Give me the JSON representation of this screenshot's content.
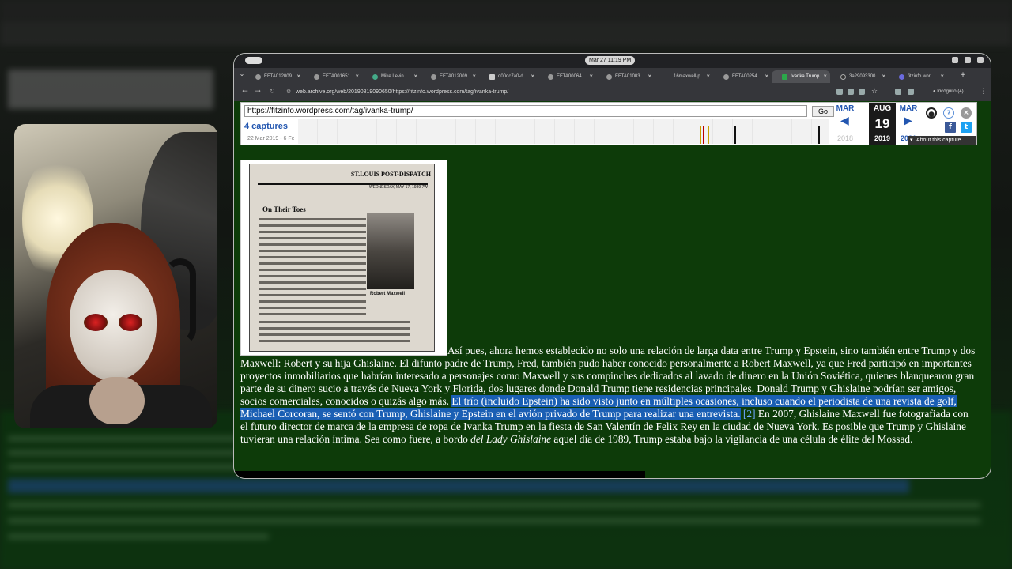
{
  "window": {
    "clock": "Mar 27  11:19 PM"
  },
  "tabs": [
    {
      "label": "EFTA012009"
    },
    {
      "label": "EFTA001651"
    },
    {
      "label": "Mike Levin"
    },
    {
      "label": "EFTA012009"
    },
    {
      "label": "d00dc7a0-d"
    },
    {
      "label": "EFTA00064"
    },
    {
      "label": "EFTA01003"
    },
    {
      "label": "16maxwell-p"
    },
    {
      "label": "EFTA00254"
    },
    {
      "label": "Ivanka Trump"
    },
    {
      "label": "3a29093300"
    },
    {
      "label": "fitzinfo.wor"
    }
  ],
  "address": {
    "url": "web.archive.org/web/20190819090650/https://fitzinfo.wordpress.com/tag/ivanka-trump/",
    "profile": "Incógnito (4)"
  },
  "wayback": {
    "url": "https://fitzinfo.wordpress.com/tag/ivanka-trump/",
    "go": "Go",
    "captures": "4 captures",
    "daterange": "22 Mar 2019 - 6 Fe",
    "prev_month": "MAR",
    "cur_month": "AUG",
    "next_month": "MAR",
    "day": "19",
    "prev_year": "2018",
    "cur_year": "2019",
    "next_year": "2021",
    "about": "About this capture"
  },
  "clipping": {
    "paper": "ST.LOUIS POST-DISPATCH",
    "date": "WEDNESDAY, MAY 17, 1989  7W",
    "headline": "On Their Toes",
    "caption": "Robert Maxwell"
  },
  "article": {
    "p1": "Así pues, ahora hemos establecido no solo una relación de larga data entre Trump y Epstein, sino también entre Trump y dos Maxwell: Robert y su hija Ghislaine. El difunto padre de Trump, Fred, también pudo haber conocido personalmente a Robert Maxwell, ya que Fred participó en importantes proyectos inmobiliarios que habrían interesado a personajes como Maxwell y sus compinches dedicados al lavado de dinero en la Unión Soviética, quienes blanquearon gran parte de su dinero sucio a través de Nueva York y Florida, dos lugares donde Donald Trump tiene residencias principales. Donald Trump y Ghislaine podrían ser amigos, socios comerciales, conocidos o quizás algo más. ",
    "sel": "El trío (incluido Epstein) ha sido visto junto en múltiples ocasiones, incluso cuando el periodista de una revista de golf, Michael Corcoran, se sentó con Trump, Ghislaine y Epstein en el avión privado de Trump para realizar una entrevista.",
    "ref": " [2]",
    "p2": " En 2007, Ghislaine Maxwell fue fotografiada con el futuro director de marca de la empresa de ropa de Ivanka Trump en la fiesta de San Valentín de Felix Rey en la ciudad de Nueva York. Es posible que Trump y Ghislaine tuvieran una relación íntima. Sea como fuere, a bordo ",
    "em": "del Lady Ghislaine",
    "p3": " aquel día de 1989, Trump estaba bajo la vigilancia de una célula de élite del Mossad."
  }
}
